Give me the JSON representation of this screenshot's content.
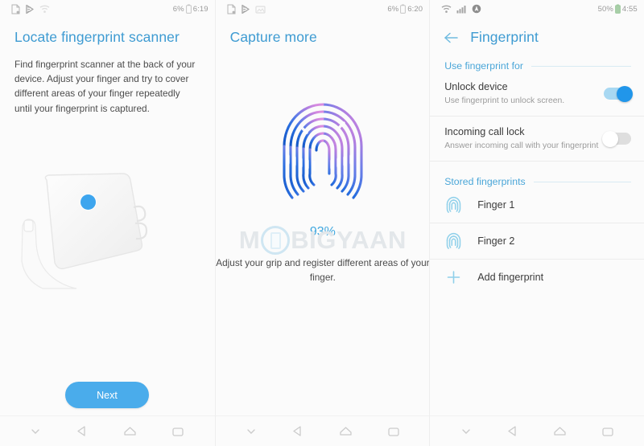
{
  "panels": [
    {
      "status": {
        "battery_percent": "6%",
        "time": "6:19",
        "icons": [
          "document-icon",
          "play-store-icon",
          "wifi-icon"
        ]
      },
      "title": "Locate fingerprint scanner",
      "body": "Find fingerprint scanner at the back of your device. Adjust your finger and try to cover different areas of your finger repeatedly until your fingerprint is captured.",
      "illustration": "hand-holding-phone-back-with-sensor",
      "next_label": "Next"
    },
    {
      "status": {
        "battery_percent": "6%",
        "time": "6:20",
        "icons": [
          "document-icon",
          "play-store-icon",
          "image-icon"
        ]
      },
      "title": "Capture more",
      "progress_percent": "93%",
      "body": "Adjust your grip and register different areas of your finger.",
      "watermark": "MOBIGYAAN"
    },
    {
      "status": {
        "battery_percent": "50%",
        "time": "4:55",
        "icons": [
          "wifi-icon",
          "signal-icon",
          "navigation-icon"
        ]
      },
      "title": "Fingerprint",
      "back_label": "back-arrow",
      "sections": [
        {
          "heading": "Use fingerprint for",
          "rows": [
            {
              "title": "Unlock device",
              "subtitle": "Use fingerprint to unlock screen.",
              "toggle": "on"
            },
            {
              "title": "Incoming call lock",
              "subtitle": "Answer incoming call with your fingerprint",
              "toggle": "off"
            }
          ]
        },
        {
          "heading": "Stored fingerprints",
          "items": [
            {
              "label": "Finger 1",
              "icon": "fingerprint-icon"
            },
            {
              "label": "Finger 2",
              "icon": "fingerprint-icon"
            },
            {
              "label": "Add fingerprint",
              "icon": "plus-icon"
            }
          ]
        }
      ]
    }
  ],
  "navbar": {
    "items": [
      "chevron-down-icon",
      "back-icon",
      "home-icon",
      "recents-icon"
    ]
  },
  "colors": {
    "accent_blue": "#3e9bd2",
    "button_blue": "#4aaceb",
    "toggle_on": "#2196ea",
    "sensor_dot": "#3da5ee"
  }
}
